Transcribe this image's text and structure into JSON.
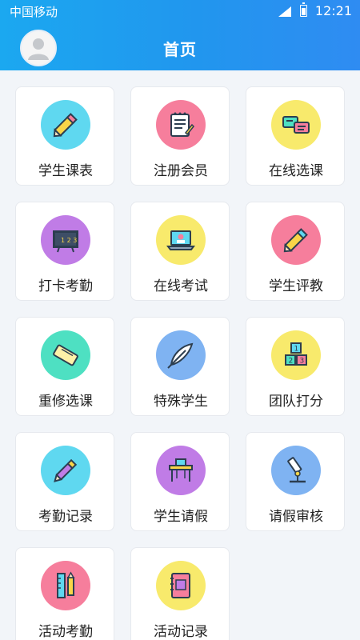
{
  "status_bar": {
    "carrier": "中国移动",
    "time": "12:21"
  },
  "header": {
    "title": "首页"
  },
  "colors": {
    "header_start": "#1ba8f0",
    "header_end": "#2f8cf2",
    "page_bg": "#f2f5f9"
  },
  "menu": [
    {
      "label": "学生课表",
      "icon": "pencil-icon",
      "bg": "#5fd8f0"
    },
    {
      "label": "注册会员",
      "icon": "notepad-icon",
      "bg": "#f67e9c"
    },
    {
      "label": "在线选课",
      "icon": "chat-bubbles-icon",
      "bg": "#f8ea6c"
    },
    {
      "label": "打卡考勤",
      "icon": "blackboard-icon",
      "bg": "#c07ce6"
    },
    {
      "label": "在线考试",
      "icon": "laptop-icon",
      "bg": "#f8ea6c"
    },
    {
      "label": "学生评教",
      "icon": "pencil-icon",
      "bg": "#f67e9c"
    },
    {
      "label": "重修选课",
      "icon": "eraser-icon",
      "bg": "#4ee0c2"
    },
    {
      "label": "特殊学生",
      "icon": "feather-icon",
      "bg": "#7fb3f2"
    },
    {
      "label": "团队打分",
      "icon": "number-blocks-icon",
      "bg": "#f8ea6c"
    },
    {
      "label": "考勤记录",
      "icon": "pen-icon",
      "bg": "#5fd8f0"
    },
    {
      "label": "学生请假",
      "icon": "desk-icon",
      "bg": "#c07ce6"
    },
    {
      "label": "请假审核",
      "icon": "microscope-icon",
      "bg": "#7fb3f2"
    },
    {
      "label": "活动考勤",
      "icon": "ruler-pencil-icon",
      "bg": "#f67e9c"
    },
    {
      "label": "活动记录",
      "icon": "notebook-icon",
      "bg": "#f8ea6c"
    }
  ]
}
